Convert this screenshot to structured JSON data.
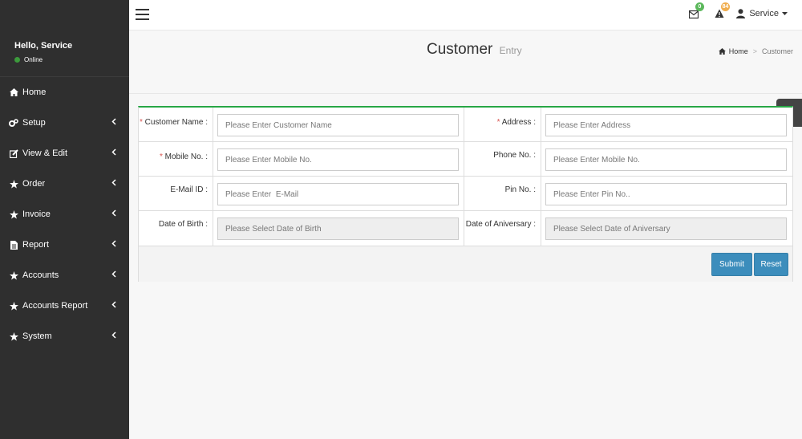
{
  "sidebar": {
    "greeting": "Hello, Service",
    "status": "Online",
    "items": [
      {
        "label": "Home",
        "icon": "home-icon"
      },
      {
        "label": "Setup",
        "icon": "cogs-icon"
      },
      {
        "label": "View & Edit",
        "icon": "edit-icon"
      },
      {
        "label": "Order",
        "icon": "star-icon"
      },
      {
        "label": "Invoice",
        "icon": "star-icon"
      },
      {
        "label": "Report",
        "icon": "file-icon"
      },
      {
        "label": "Accounts",
        "icon": "star-icon"
      },
      {
        "label": "Accounts Report",
        "icon": "star-icon"
      },
      {
        "label": "System",
        "icon": "star-icon"
      }
    ]
  },
  "topbar": {
    "mail_count": "0",
    "alert_count": "84",
    "user_name": "Service"
  },
  "header": {
    "title": "Customer",
    "subtitle": "Entry",
    "breadcrumb_home": "Home",
    "breadcrumb_current": "Customer"
  },
  "form": {
    "customer_name": {
      "label": "Customer Name :",
      "placeholder": "Please Enter Customer Name"
    },
    "address": {
      "label": "Address :",
      "placeholder": "Please Enter Address"
    },
    "mobile": {
      "label": "Mobile No. :",
      "placeholder": "Please Enter Mobile No."
    },
    "phone": {
      "label": "Phone No. :",
      "placeholder": "Please Enter Mobile No."
    },
    "email": {
      "label": "E-Mail ID :",
      "placeholder": "Please Enter  E-Mail"
    },
    "pin": {
      "label": "Pin No. :",
      "placeholder": "Please Enter Pin No.."
    },
    "dob": {
      "label": "Date of Birth :",
      "placeholder": "Please Select Date of Birth"
    },
    "anniversary": {
      "label": "Date of Aniversary :",
      "placeholder": "Please Select Date of Aniversary"
    },
    "required_mark": "*",
    "submit_label": "Submit",
    "reset_label": "Reset"
  },
  "colors": {
    "sidebar_bg": "#2f2f2f",
    "accent": "#3c8dbc",
    "panel_top": "#28a745",
    "online": "#3c9a3c",
    "mail_badge": "#5cb85c",
    "alert_badge": "#f0ad4e"
  }
}
